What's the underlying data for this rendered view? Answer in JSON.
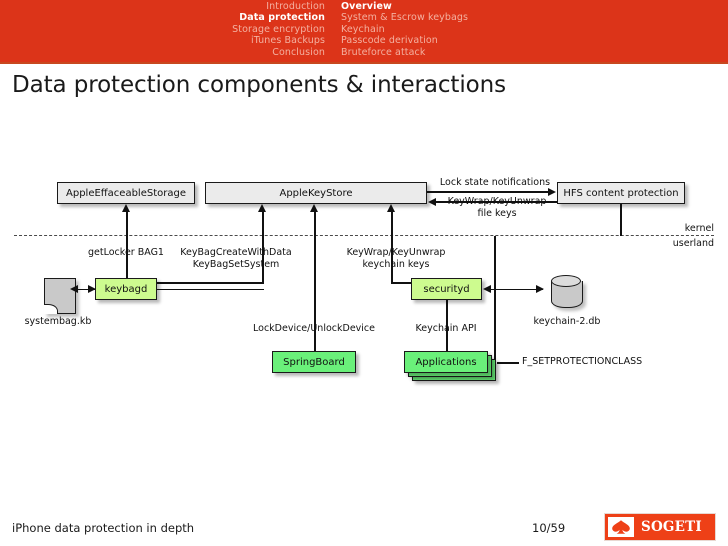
{
  "header": {
    "nav_left": [
      {
        "label": "Introduction",
        "active": false
      },
      {
        "label": "Data protection",
        "active": true
      },
      {
        "label": "Storage encryption",
        "active": false
      },
      {
        "label": "iTunes Backups",
        "active": false
      },
      {
        "label": "Conclusion",
        "active": false
      }
    ],
    "nav_right": [
      {
        "label": "Overview",
        "active": true
      },
      {
        "label": "System & Escrow keybags",
        "active": false
      },
      {
        "label": "Keychain",
        "active": false
      },
      {
        "label": "Passcode derivation",
        "active": false
      },
      {
        "label": "Bruteforce attack",
        "active": false
      }
    ],
    "bar_color": "#dc3419",
    "active_color": "#ffffff",
    "inactive_color": "#f4b0a0"
  },
  "slide": {
    "title": "Data protection components & interactions"
  },
  "diagram": {
    "kernel_label": "kernel",
    "userland_label": "userland",
    "boxes": {
      "apple_effaceable_storage": "AppleEffaceableStorage",
      "apple_key_store": "AppleKeyStore",
      "hfs_content_protection": "HFS content protection",
      "keybagd": "keybagd",
      "securityd": "securityd",
      "springboard": "SpringBoard",
      "applications": "Applications"
    },
    "stores": {
      "systembag": "systembag.kb",
      "keychain_db": "keychain-2.db"
    },
    "edge_labels": {
      "lock_state_notifications": "Lock state notifications",
      "keywrap_file_keys_line1": "KeyWrap/KeyUnwrap",
      "keywrap_file_keys_line2": "file keys",
      "get_locker": "getLocker BAG1",
      "keybag_create_line1": "KeyBagCreateWithData",
      "keybag_create_line2": "KeyBagSetSystem",
      "keywrap_keychain_line1": "KeyWrap/KeyUnwrap",
      "keywrap_keychain_line2": "keychain keys",
      "lock_unlock_device": "LockDevice/UnlockDevice",
      "keychain_api": "Keychain API",
      "set_protection_class": "F_SETPROTECTIONCLASS"
    },
    "colors": {
      "kernel_box": "#ebebeb",
      "daemon_box": "#cdfb8f",
      "app_box": "#6af07a"
    }
  },
  "footer": {
    "title": "iPhone data protection in depth",
    "page": "10/59",
    "logo_text": "SOGETI",
    "logo_color": "#ee4017"
  }
}
